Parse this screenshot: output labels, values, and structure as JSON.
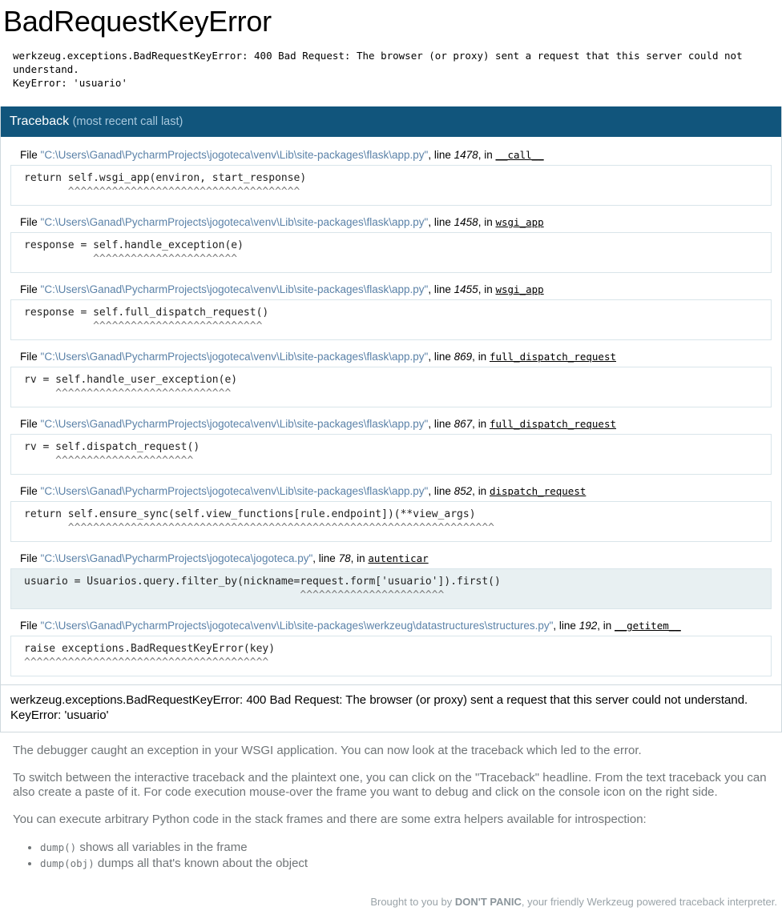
{
  "page": {
    "title": "BadRequestKeyError",
    "exception_summary": "werkzeug.exceptions.BadRequestKeyError: 400 Bad Request: The browser (or proxy) sent a request that this server could not understand.\nKeyError: 'usuario'"
  },
  "traceback": {
    "header_title": "Traceback",
    "header_subtitle": "(most recent call last)",
    "file_keyword": "File",
    "line_keyword": "line",
    "in_keyword": "in",
    "frames": [
      {
        "filename": "\"C:\\Users\\Ganad\\PycharmProjects\\jogoteca\\venv\\Lib\\site-packages\\flask\\app.py\"",
        "lineno": "1478",
        "function": "__call__",
        "code": "return self.wsgi_app(environ, start_response)",
        "carets": "       ^^^^^^^^^^^^^^^^^^^^^^^^^^^^^^^^^^^^^",
        "current": false
      },
      {
        "filename": "\"C:\\Users\\Ganad\\PycharmProjects\\jogoteca\\venv\\Lib\\site-packages\\flask\\app.py\"",
        "lineno": "1458",
        "function": "wsgi_app",
        "code": "response = self.handle_exception(e)",
        "carets": "           ^^^^^^^^^^^^^^^^^^^^^^^",
        "current": false
      },
      {
        "filename": "\"C:\\Users\\Ganad\\PycharmProjects\\jogoteca\\venv\\Lib\\site-packages\\flask\\app.py\"",
        "lineno": "1455",
        "function": "wsgi_app",
        "code": "response = self.full_dispatch_request()",
        "carets": "           ^^^^^^^^^^^^^^^^^^^^^^^^^^^",
        "current": false
      },
      {
        "filename": "\"C:\\Users\\Ganad\\PycharmProjects\\jogoteca\\venv\\Lib\\site-packages\\flask\\app.py\"",
        "lineno": "869",
        "function": "full_dispatch_request",
        "code": "rv = self.handle_user_exception(e)",
        "carets": "     ^^^^^^^^^^^^^^^^^^^^^^^^^^^^",
        "current": false
      },
      {
        "filename": "\"C:\\Users\\Ganad\\PycharmProjects\\jogoteca\\venv\\Lib\\site-packages\\flask\\app.py\"",
        "lineno": "867",
        "function": "full_dispatch_request",
        "code": "rv = self.dispatch_request()",
        "carets": "     ^^^^^^^^^^^^^^^^^^^^^^",
        "current": false
      },
      {
        "filename": "\"C:\\Users\\Ganad\\PycharmProjects\\jogoteca\\venv\\Lib\\site-packages\\flask\\app.py\"",
        "lineno": "852",
        "function": "dispatch_request",
        "code": "return self.ensure_sync(self.view_functions[rule.endpoint])(**view_args)",
        "carets": "       ^^^^^^^^^^^^^^^^^^^^^^^^^^^^^^^^^^^^^^^^^^^^^^^^^^^^^^^^^^^^^^^^^^^^",
        "current": false
      },
      {
        "filename": "\"C:\\Users\\Ganad\\PycharmProjects\\jogoteca\\jogoteca.py\"",
        "lineno": "78",
        "function": "autenticar",
        "code": "usuario = Usuarios.query.filter_by(nickname=request.form['usuario']).first()",
        "carets": "                                            ^^^^^^^^^^^^^^^^^^^^^^^",
        "current": true
      },
      {
        "filename": "\"C:\\Users\\Ganad\\PycharmProjects\\jogoteca\\venv\\Lib\\site-packages\\werkzeug\\datastructures\\structures.py\"",
        "lineno": "192",
        "function": "__getitem__",
        "code": "raise exceptions.BadRequestKeyError(key)",
        "carets": "^^^^^^^^^^^^^^^^^^^^^^^^^^^^^^^^^^^^^^^",
        "current": false
      }
    ],
    "footer_text": "werkzeug.exceptions.BadRequestKeyError: 400 Bad Request: The browser (or proxy) sent a request that this server could not understand.\nKeyError: 'usuario'"
  },
  "explanation": {
    "paragraph_1": "The debugger caught an exception in your WSGI application. You can now look at the traceback which led to the error.",
    "paragraph_2": "To switch between the interactive traceback and the plaintext one, you can click on the \"Traceback\" headline. From the text traceback you can also create a paste of it. For code execution mouse-over the frame you want to debug and click on the console icon on the right side.",
    "paragraph_3": "You can execute arbitrary Python code in the stack frames and there are some extra helpers available for introspection:",
    "helpers": [
      {
        "code": "dump()",
        "text": " shows all variables in the frame"
      },
      {
        "code": "dump(obj)",
        "text": " dumps all that's known about the object"
      }
    ]
  },
  "footer": {
    "prefix": "Brought to you by ",
    "brand": "DON'T PANIC",
    "suffix": ", your friendly Werkzeug powered traceback interpreter."
  },
  "colors": {
    "header_bg": "#11557c",
    "header_sub": "#a8c8dd",
    "path_link": "#5b82a8",
    "current_frame_bg": "#e8f0f2",
    "code_border": "#d9e5ea",
    "muted_text": "#6f7477"
  }
}
